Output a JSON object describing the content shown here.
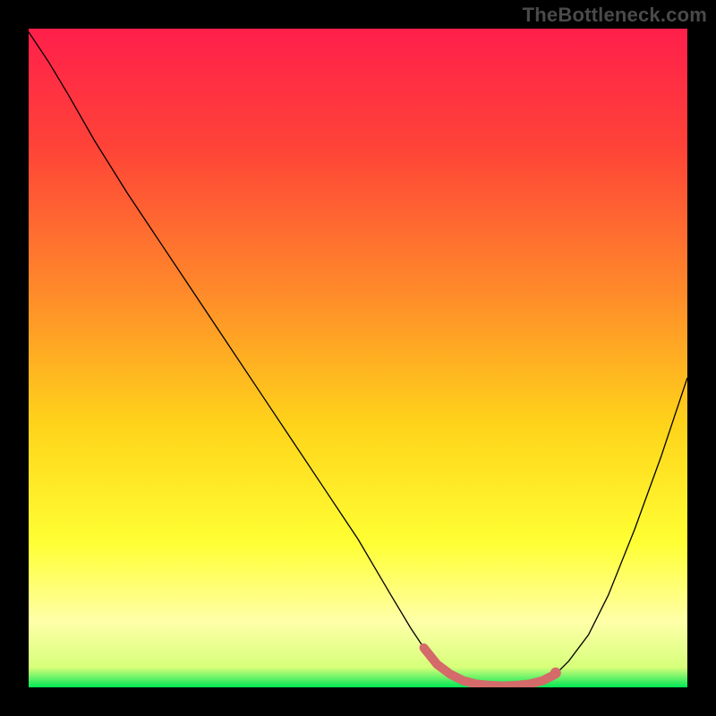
{
  "attribution": "TheBottleneck.com",
  "chart_data": {
    "type": "line",
    "title": "",
    "xlabel": "",
    "ylabel": "",
    "xlim": [
      0,
      100
    ],
    "ylim": [
      0,
      100
    ],
    "gradient_stops": [
      {
        "offset": 0,
        "color": "#ff1f4b"
      },
      {
        "offset": 18,
        "color": "#ff4338"
      },
      {
        "offset": 40,
        "color": "#ff8a2a"
      },
      {
        "offset": 60,
        "color": "#ffd31a"
      },
      {
        "offset": 78,
        "color": "#ffff33"
      },
      {
        "offset": 90,
        "color": "#ffffa8"
      },
      {
        "offset": 97,
        "color": "#d6ff7a"
      },
      {
        "offset": 100,
        "color": "#00e756"
      }
    ],
    "curve": {
      "x": [
        0,
        1,
        3,
        6,
        10,
        15,
        20,
        25,
        30,
        35,
        40,
        45,
        50,
        55,
        58,
        60,
        62,
        64,
        66,
        68,
        70,
        72,
        74,
        76,
        78,
        80,
        82,
        85,
        88,
        92,
        96,
        100
      ],
      "y": [
        99.5,
        98,
        95,
        90,
        83,
        75,
        67.5,
        60,
        52.5,
        45,
        37.5,
        30,
        22.5,
        14,
        9,
        6,
        3.5,
        2,
        1,
        0.5,
        0.3,
        0.2,
        0.3,
        0.5,
        1,
        2,
        4,
        8,
        14,
        24,
        35,
        47
      ]
    },
    "marker_band": {
      "x": [
        60,
        62,
        64,
        66,
        68,
        70,
        72,
        74,
        76,
        78,
        80
      ],
      "y": [
        6,
        3.5,
        2,
        1,
        0.5,
        0.3,
        0.2,
        0.3,
        0.5,
        1,
        2
      ],
      "color": "#d46a6a",
      "width": 10
    },
    "marker_dot": {
      "x": 80,
      "y": 2.2,
      "r": 6,
      "color": "#d46a6a"
    }
  }
}
